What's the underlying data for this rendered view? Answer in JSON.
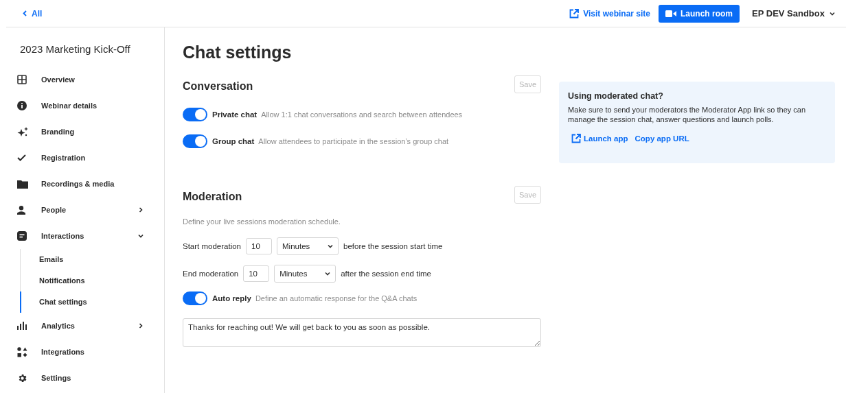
{
  "header": {
    "back_link": "All",
    "visit_link": "Visit webinar site",
    "launch_button": "Launch room",
    "account": "EP DEV Sandbox"
  },
  "sidebar": {
    "title": "2023 Marketing Kick-Off",
    "items": [
      {
        "label": "Overview"
      },
      {
        "label": "Webinar details"
      },
      {
        "label": "Branding"
      },
      {
        "label": "Registration"
      },
      {
        "label": "Recordings & media"
      },
      {
        "label": "People",
        "expanded": false
      },
      {
        "label": "Interactions",
        "expanded": true,
        "children": [
          {
            "label": "Emails",
            "selected": false
          },
          {
            "label": "Notifications",
            "selected": false
          },
          {
            "label": "Chat settings",
            "selected": true
          }
        ]
      },
      {
        "label": "Analytics",
        "expanded": false
      },
      {
        "label": "Integrations"
      },
      {
        "label": "Settings"
      }
    ]
  },
  "page_title": "Chat settings",
  "conversation": {
    "heading": "Conversation",
    "save_button": {
      "label": "Save",
      "disabled": true
    },
    "toggles": [
      {
        "label": "Private chat",
        "description": "Allow 1:1 chat conversations and search between attendees",
        "on": true
      },
      {
        "label": "Group chat",
        "description": "Allow attendees to participate in the session’s group chat",
        "on": true
      }
    ]
  },
  "moderation": {
    "heading": "Moderation",
    "save_button": {
      "label": "Save",
      "disabled": true
    },
    "description": "Define your live sessions moderation schedule.",
    "schedule": [
      {
        "label": "Start moderation",
        "value": "10",
        "unit": "Minutes",
        "suffix": "before the session start time"
      },
      {
        "label": "End moderation",
        "value": "10",
        "unit": "Minutes",
        "suffix": "after the session end time"
      }
    ],
    "auto_reply": {
      "label": "Auto reply",
      "description": "Define an automatic response for the Q&A chats",
      "on": true
    },
    "reply_text": "Thanks for reaching out! We will get back to you as soon as possible."
  },
  "info_card": {
    "title": "Using moderated chat?",
    "text": "Make sure to send your moderators the Moderator App link so they can manage the session chat, answer questions and launch polls.",
    "launch_link": "Launch app",
    "copy_link": "Copy app URL"
  }
}
